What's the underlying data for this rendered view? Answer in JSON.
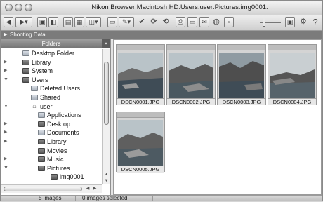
{
  "window": {
    "title": "Nikon Browser Macintosh HD:Users:user:Pictures:img0001:"
  },
  "toolbar": {
    "icons": [
      "back-icon",
      "forward-icon",
      "view-mode-icon",
      "folder-icon",
      "edit-icon",
      "check-icon",
      "rotate-icon",
      "print-icon",
      "email-icon",
      "settings-icon",
      "info-icon",
      "help-icon"
    ],
    "help_label": "?"
  },
  "shooting_data": {
    "label": "Shooting Data"
  },
  "folders": {
    "header": "Folders",
    "close_label": "×",
    "items": [
      {
        "label": "Desktop Folder",
        "level": 0,
        "disclosure": "",
        "icon": "folder-icon"
      },
      {
        "label": "Library",
        "level": 0,
        "disclosure": "▶",
        "icon": "folder-dark-icon"
      },
      {
        "label": "System",
        "level": 0,
        "disclosure": "▶",
        "icon": "folder-dark-icon"
      },
      {
        "label": "Users",
        "level": 0,
        "disclosure": "▼",
        "icon": "folder-dark-icon"
      },
      {
        "label": "Deleted Users",
        "level": 1,
        "disclosure": "",
        "icon": "folder-icon"
      },
      {
        "label": "Shared",
        "level": 1,
        "disclosure": "",
        "icon": "folder-icon"
      },
      {
        "label": "user",
        "level": 1,
        "disclosure": "▼",
        "icon": "home-icon"
      },
      {
        "label": "Applications",
        "level": 2,
        "disclosure": "",
        "icon": "folder-icon"
      },
      {
        "label": "Desktop",
        "level": 2,
        "disclosure": "▶",
        "icon": "folder-dark-icon"
      },
      {
        "label": "Documents",
        "level": 2,
        "disclosure": "▶",
        "icon": "folder-icon"
      },
      {
        "label": "Library",
        "level": 2,
        "disclosure": "▶",
        "icon": "folder-dark-icon"
      },
      {
        "label": "Movies",
        "level": 2,
        "disclosure": "",
        "icon": "folder-dark-icon"
      },
      {
        "label": "Music",
        "level": 2,
        "disclosure": "▶",
        "icon": "folder-dark-icon"
      },
      {
        "label": "Pictures",
        "level": 2,
        "disclosure": "▼",
        "icon": "folder-dark-icon"
      },
      {
        "label": "img0001",
        "level": 3,
        "disclosure": "",
        "icon": "folder-dark-icon"
      }
    ]
  },
  "thumbnails": [
    {
      "file": "DSCN0001.JPG"
    },
    {
      "file": "DSCN0002.JPG"
    },
    {
      "file": "DSCN0003.JPG"
    },
    {
      "file": "DSCN0004.JPG"
    },
    {
      "file": "DSCN0005.JPG"
    }
  ],
  "status": {
    "count": "5 images",
    "selected": "0 images selected"
  },
  "colors": {
    "water": "#3f4c56",
    "sky": "#b9c3c8",
    "rock": "#585858"
  }
}
